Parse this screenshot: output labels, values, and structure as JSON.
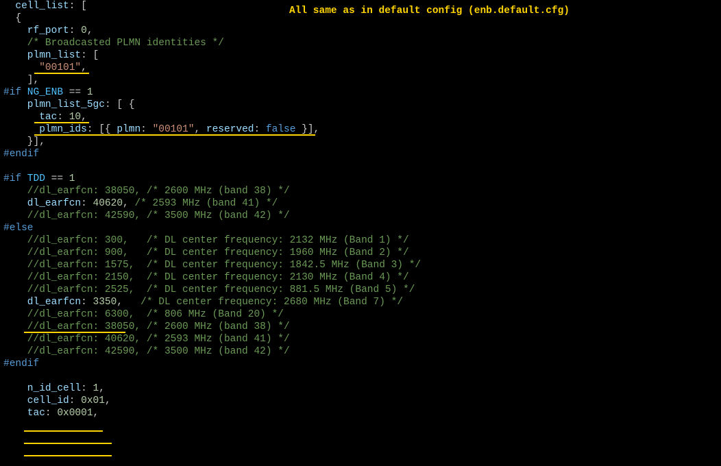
{
  "annotation": "All same as in default config (enb.default.cfg)",
  "lines": {
    "l01a": "  cell_list",
    "l01b": ": [",
    "l02": "  {",
    "l03a": "    rf_port",
    "l03b": ": ",
    "l03c": "0",
    "l03d": ",",
    "l04": "    /* Broadcasted PLMN identities */",
    "l05a": "    plmn_list",
    "l05b": ": [",
    "l06": "      \"00101\"",
    "l06b": ",",
    "l07": "    ],",
    "l08a": "#if",
    "l08b": " NG_ENB",
    "l08c": " == ",
    "l08d": "1",
    "l09a": "    plmn_list_5gc",
    "l09b": ": [ {",
    "l10a": "      tac",
    "l10b": ": ",
    "l10c": "10",
    "l10d": ",",
    "l11a": "      plmn_ids",
    "l11b": ": [{ ",
    "l11c": "plmn",
    "l11d": ": ",
    "l11e": "\"00101\"",
    "l11f": ", ",
    "l11g": "reserved",
    "l11h": ": ",
    "l11i": "false",
    "l11j": " }],",
    "l12": "    }],",
    "l13": "#endif",
    "l15a": "#if",
    "l15b": " TDD",
    "l15c": " == ",
    "l15d": "1",
    "l16": "    //dl_earfcn: 38050, /* 2600 MHz (band 38) */",
    "l17a": "    dl_earfcn",
    "l17b": ": ",
    "l17c": "40620",
    "l17d": ", ",
    "l17e": "/* 2593 MHz (band 41) */",
    "l18": "    //dl_earfcn: 42590, /* 3500 MHz (band 42) */",
    "l19": "#else",
    "l20": "    //dl_earfcn: 300,   /* DL center frequency: 2132 MHz (Band 1) */",
    "l21": "    //dl_earfcn: 900,   /* DL center frequency: 1960 MHz (Band 2) */",
    "l22": "    //dl_earfcn: 1575,  /* DL center frequency: 1842.5 MHz (Band 3) */",
    "l23": "    //dl_earfcn: 2150,  /* DL center frequency: 2130 MHz (Band 4) */",
    "l24": "    //dl_earfcn: 2525,  /* DL center frequency: 881.5 MHz (Band 5) */",
    "l25a": "    dl_earfcn",
    "l25b": ": ",
    "l25c": "3350",
    "l25d": ",   ",
    "l25e": "/* DL center frequency: 2680 MHz (Band 7) */",
    "l26": "    //dl_earfcn: 6300,  /* 806 MHz (Band 20) */",
    "l27": "    //dl_earfcn: 38050, /* 2600 MHz (band 38) */",
    "l28": "    //dl_earfcn: 40620, /* 2593 MHz (band 41) */",
    "l29": "    //dl_earfcn: 42590, /* 3500 MHz (band 42) */",
    "l30": "#endif",
    "l32a": "    n_id_cell",
    "l32b": ": ",
    "l32c": "1",
    "l32d": ",",
    "l33a": "    cell_id",
    "l33b": ": ",
    "l33c": "0x01",
    "l33d": ",",
    "l34a": "    tac",
    "l34b": ": ",
    "l34c": "0x0001",
    "l34d": ","
  }
}
